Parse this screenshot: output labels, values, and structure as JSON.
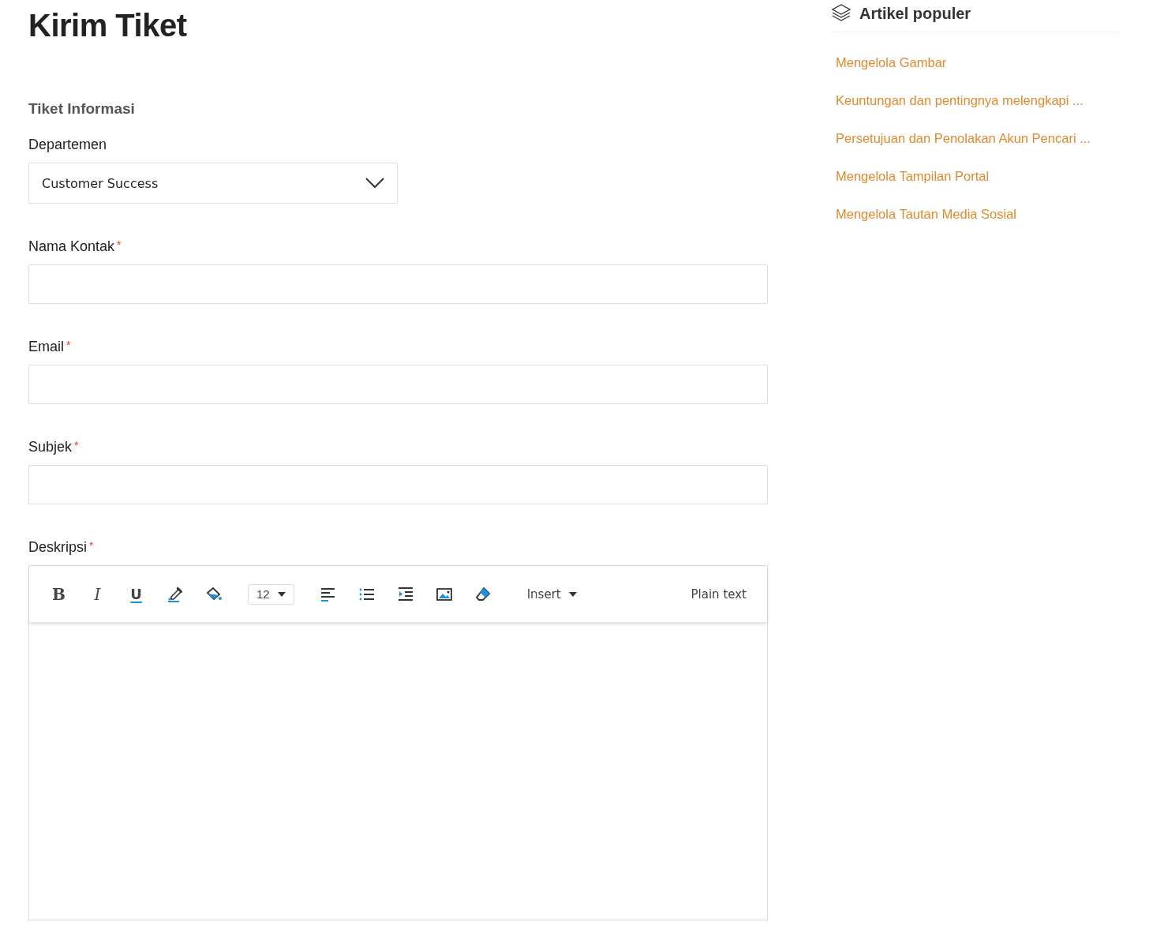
{
  "title": "Kirim Tiket",
  "section": "Tiket Informasi",
  "fields": [
    {
      "kind": "select",
      "label": "Departemen",
      "required": false,
      "value": "Customer Success"
    },
    {
      "kind": "text",
      "label": "Nama Kontak",
      "required": true
    },
    {
      "kind": "text",
      "label": "Email",
      "required": true
    },
    {
      "kind": "text",
      "label": "Subjek",
      "required": true
    },
    {
      "kind": "editor",
      "label": "Deskripsi",
      "required": true
    }
  ],
  "required_mark": "*",
  "editor": {
    "bold": "B",
    "italic": "I",
    "underline": "U",
    "font_size": "12",
    "insert": "Insert",
    "mode": "Plain text"
  },
  "sidebar": {
    "title": "Artikel populer",
    "articles": [
      "Mengelola Gambar",
      "Keuntungan dan pentingnya melengkapi ...",
      "Persetujuan dan Penolakan Akun Pencari ...",
      "Mengelola Tampilan Portal",
      "Mengelola Tautan Media Sosial"
    ]
  }
}
